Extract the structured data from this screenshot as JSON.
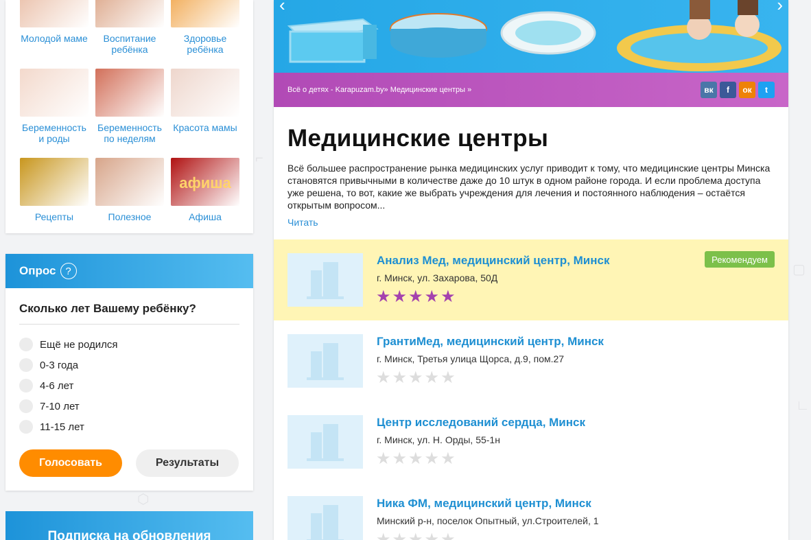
{
  "categories": [
    {
      "label": "Молодой маме",
      "icon": "mother-baby-photo",
      "color": "#e8b9a0"
    },
    {
      "label": "Воспитание ребёнка",
      "icon": "children-hands-photo",
      "color": "#d99f7f"
    },
    {
      "label": "Здоровье ребёнка",
      "icon": "vegetables-photo",
      "color": "#f0a040"
    },
    {
      "label": "Беременность и роды",
      "icon": "pregnant-belly-photo",
      "color": "#f3d9cc"
    },
    {
      "label": "Беременность по неделям",
      "icon": "fetus-photo",
      "color": "#d2705a"
    },
    {
      "label": "Красота мамы",
      "icon": "makeup-woman-photo",
      "color": "#eed6cc"
    },
    {
      "label": "Рецепты",
      "icon": "paella-photo",
      "color": "#c8961e"
    },
    {
      "label": "Полезное",
      "icon": "baby-hand-photo",
      "color": "#d7a58a"
    },
    {
      "label": "Афиша",
      "icon": "afisha-neon-photo",
      "color": "#b01212",
      "sign": "афиша"
    }
  ],
  "poll": {
    "title": "Опрос",
    "help": "?",
    "question": "Сколько лет Вашему ребёнку?",
    "options": [
      "Ещё не родился",
      "0-3 года",
      "4-6 лет",
      "7-10 лет",
      "11-15 лет"
    ],
    "vote_label": "Голосовать",
    "results_label": "Результаты"
  },
  "subscription": {
    "title": "Подписка на обновления"
  },
  "breadcrumb": "Всё о детях - Karapuzam.by» Медицинские центры »",
  "social": [
    {
      "name": "vk",
      "glyph": "вк",
      "color": "#4a76a8"
    },
    {
      "name": "facebook",
      "glyph": "f",
      "color": "#3b5998"
    },
    {
      "name": "odnoklassniki",
      "glyph": "ок",
      "color": "#ee8208"
    },
    {
      "name": "twitter",
      "glyph": "t",
      "color": "#1da1f2"
    }
  ],
  "page": {
    "title": "Медицинские центры",
    "intro": "Всё большее распространение рынка медицинских услуг приводит к тому, что медицинские центры Минска становятся привычными в количестве даже до 10 штук в одном районе города. И если проблема доступа уже решена, то вот, какие же выбрать учреждения для лечения и постоянного наблюдения – остаётся открытым вопросом...",
    "read_more": "Читать"
  },
  "listings": [
    {
      "name": "Анализ Мед, медицинский центр, Минск",
      "address": "г. Минск, ул. Захарова, 50Д",
      "rating": 5,
      "featured": true,
      "badge": "Рекомендуем"
    },
    {
      "name": "ГрантиМед, медицинский центр, Минск",
      "address": "г. Минск, Третья улица Щорса, д.9, пом.27",
      "rating": 0,
      "featured": false
    },
    {
      "name": "Центр исследований сердца, Минск",
      "address": "г. Минск, ул. Н. Орды, 55-1н",
      "rating": 0,
      "featured": false
    },
    {
      "name": "Ника ФМ, медицинский центр, Минск",
      "address": "Минский р-н, поселок Опытный, ул.Строителей, 1",
      "rating": 0,
      "featured": false
    }
  ]
}
